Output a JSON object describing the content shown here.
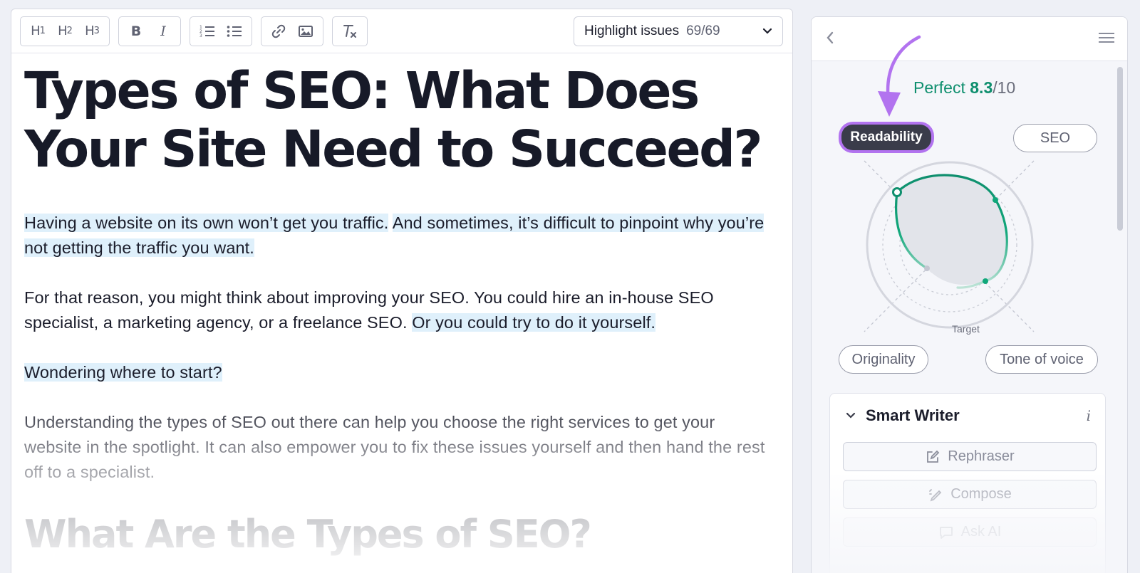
{
  "toolbar": {
    "h1": "H",
    "h2": "H",
    "h3": "H",
    "h1_sub": "1",
    "h2_sub": "2",
    "h3_sub": "3",
    "bold": "B",
    "italic": "I",
    "highlight_label": "Highlight issues",
    "highlight_count": "69/69"
  },
  "article": {
    "title": "Types of SEO: What Does Your Site Need to Succeed?",
    "p1_a": "Having a website on its own won’t get you traffic.",
    "p1_b": "And sometimes, it’s difficult to pinpoint why you’re not getting the traffic you want.",
    "p2_a": "For that reason, you might think about improving your SEO. You could hire an in-house SEO specialist, a marketing agency, or a freelance SEO.",
    "p2_b": "Or you could try to do it yourself.",
    "p3": "Wondering where to start?",
    "p4": "Understanding the types of SEO out there can help you choose the right services to get your website in the spotlight. It can also empower you to fix these issues yourself and then hand the rest off to a specialist.",
    "h2": "What Are the Types of SEO?"
  },
  "sidebar": {
    "score_label": "Perfect",
    "score_value": "8.3",
    "score_max": "/10",
    "tabs": {
      "readability": "Readability",
      "seo": "SEO",
      "originality": "Originality",
      "tone": "Tone of voice"
    },
    "target_label": "Target",
    "radar_scores": {
      "readability": 0.83,
      "seo": 0.78,
      "tone_of_voice": 0.7,
      "originality": 0.28
    },
    "smart_writer": {
      "title": "Smart Writer",
      "buttons": [
        "Rephraser",
        "Compose",
        "Ask AI"
      ]
    }
  },
  "colors": {
    "accent_green": "#0f8f6e",
    "highlight_blue": "#dff0fb",
    "callout_purple": "#b273ef"
  },
  "icons": [
    "link-icon",
    "image-icon",
    "clear-format-icon",
    "ordered-list-icon",
    "unordered-list-icon",
    "chevron-left-icon",
    "menu-icon",
    "edit-icon",
    "compose-icon",
    "chat-icon"
  ]
}
